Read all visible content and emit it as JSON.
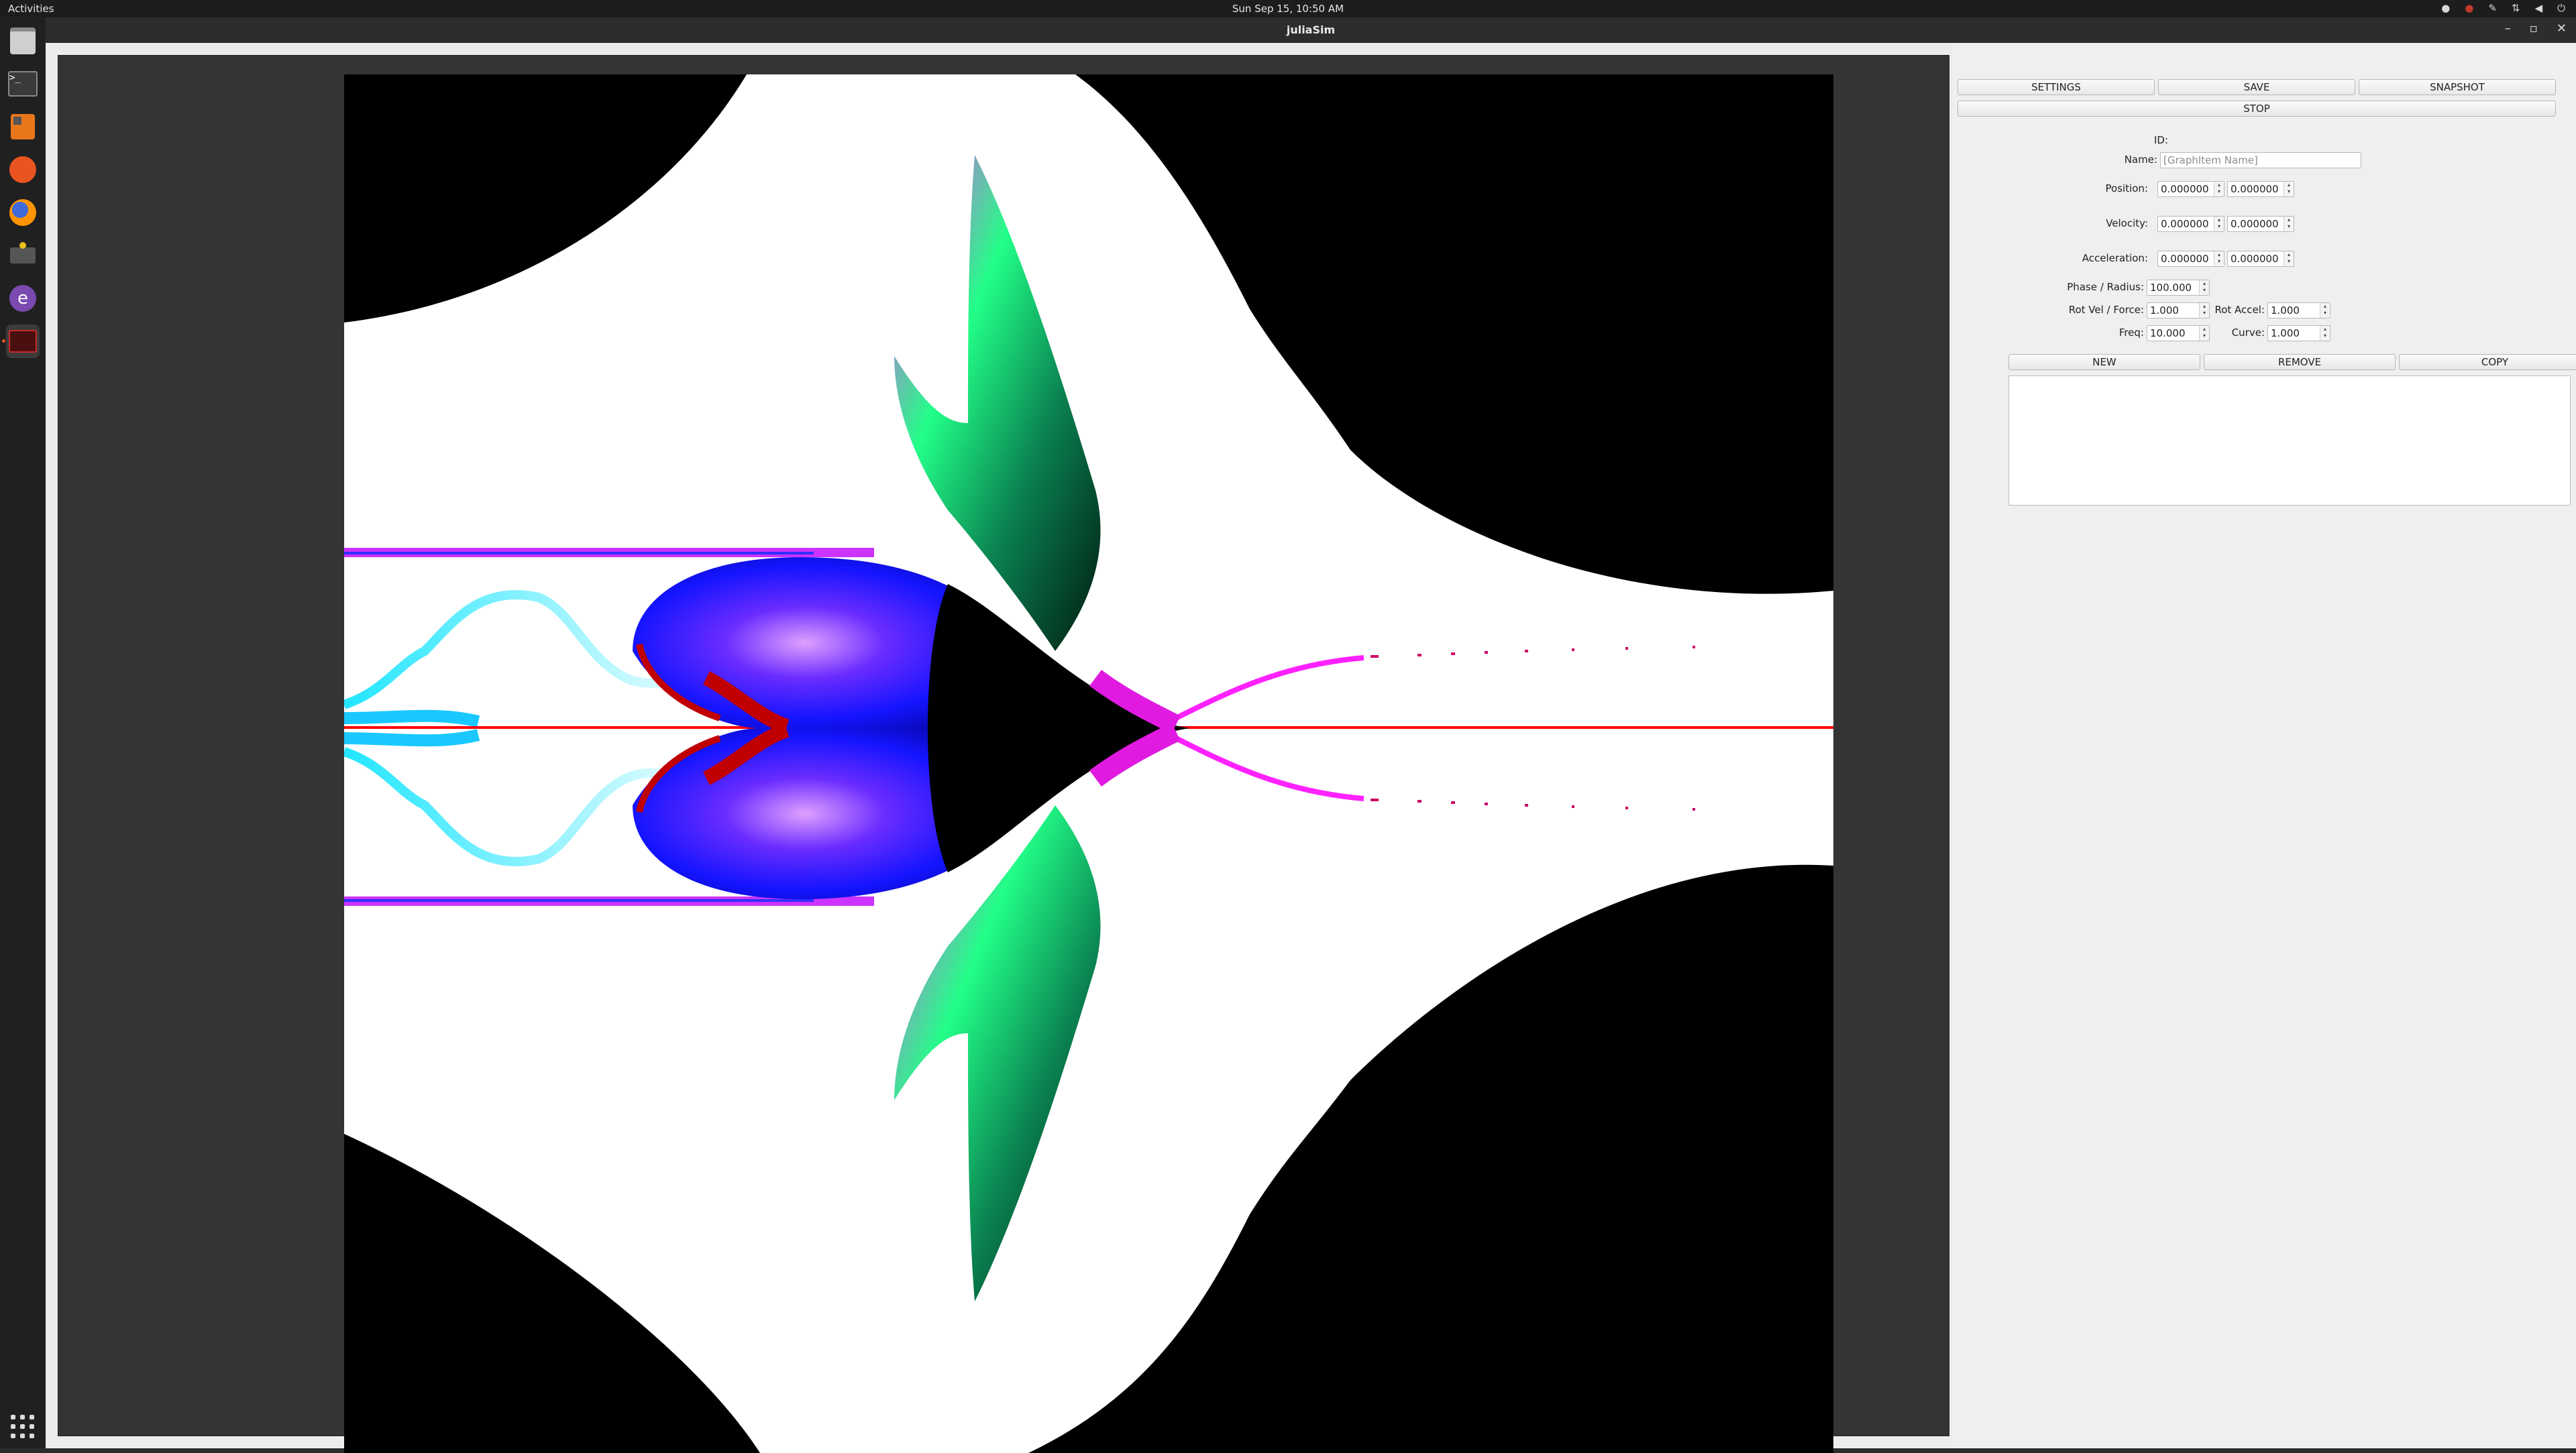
{
  "topbar": {
    "activities": "Activities",
    "clock": "Sun Sep 15, 10:50 AM"
  },
  "dock": {
    "items": [
      "files",
      "terminal",
      "calculator",
      "music",
      "firefox",
      "terminal-tools",
      "emacs",
      "screenshot"
    ]
  },
  "window": {
    "title": "juliaSim",
    "controls": [
      "–",
      "▫",
      "✕"
    ]
  },
  "toolbar": {
    "settings": "SETTINGS",
    "save": "SAVE",
    "snapshot": "SNAPSHOT",
    "stop": "STOP"
  },
  "props": {
    "id_label": "ID:",
    "name_label": "Name:",
    "name_placeholder": "[GraphItem Name]",
    "position_label": "Position:",
    "position_x": "0.000000",
    "position_y": "0.000000",
    "velocity_label": "Velocity:",
    "velocity_x": "0.000000",
    "velocity_y": "0.000000",
    "acceleration_label": "Acceleration:",
    "acceleration_x": "0.000000",
    "acceleration_y": "0.000000",
    "phase_label": "Phase / Radius:",
    "phase_value": "100.000",
    "rotvel_label": "Rot Vel / Force:",
    "rotvel_value": "1.000",
    "rotaccel_label": "Rot Accel:",
    "rotaccel_value": "1.000",
    "freq_label": "Freq:",
    "freq_value": "10.000",
    "curve_label": "Curve:",
    "curve_value": "1.000"
  },
  "actions": {
    "new": "NEW",
    "remove": "REMOVE",
    "copy": "COPY"
  },
  "colors": {
    "fractal_bg": "#ffffff",
    "fractal_dark": "#000000",
    "blue": "#1a1aff",
    "magenta": "#ff22ff",
    "green": "#22ff88",
    "cyan": "#22e6ff",
    "red": "#ff0000"
  }
}
